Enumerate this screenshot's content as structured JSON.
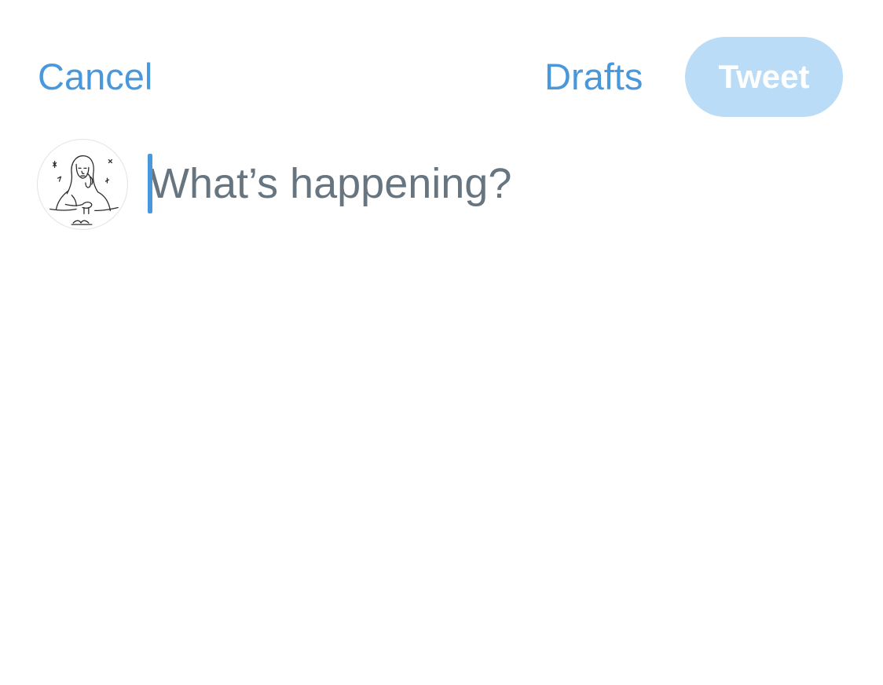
{
  "header": {
    "cancel_label": "Cancel",
    "drafts_label": "Drafts",
    "tweet_label": "Tweet"
  },
  "composer": {
    "placeholder": "What’s happening?",
    "value": ""
  },
  "avatar": {
    "icon": "user-sketch-avatar-icon"
  },
  "colors": {
    "accent": "#4a98dc",
    "tweet_button_disabled": "#badcf6",
    "placeholder": "#66757f",
    "background": "#ffffff"
  }
}
